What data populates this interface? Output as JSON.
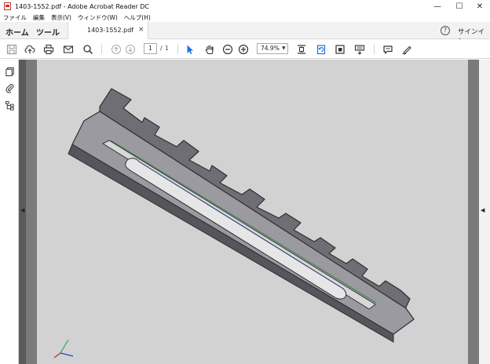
{
  "window": {
    "title": "1403-1552.pdf - Adobe Acrobat Reader DC",
    "minimize": "—",
    "maximize": "☐",
    "close": "✕"
  },
  "menu": [
    "ファイル",
    "編集",
    "表示(V)",
    "ウィンドウ(W)",
    "ヘルプ(H)"
  ],
  "tabs": {
    "home": "ホーム",
    "tools": "ツール",
    "document": "1403-1552.pdf",
    "close": "×"
  },
  "header": {
    "help": "?",
    "signin": "サインイン"
  },
  "toolbar": {
    "page_current": "1",
    "page_sep": "/",
    "page_total": "1",
    "zoom": "74.9%",
    "zoom_caret": "▼"
  },
  "panes": {
    "collapse_left": "◀",
    "collapse_right": "◀"
  },
  "colors": {
    "select_tool": "#1a73e8",
    "part_surface": "#7b7b80",
    "page_bg": "#d2d2d2"
  },
  "icons": [
    "save-icon",
    "upload-icon",
    "print-icon",
    "mail-icon",
    "search-icon",
    "prev-page-icon",
    "next-page-icon",
    "select-cursor-icon",
    "hand-icon",
    "zoom-out-icon",
    "zoom-in-icon",
    "fit-page-icon",
    "rotate-icon",
    "read-mode-icon",
    "keyboard-scroll-icon",
    "comment-icon",
    "sign-icon"
  ]
}
